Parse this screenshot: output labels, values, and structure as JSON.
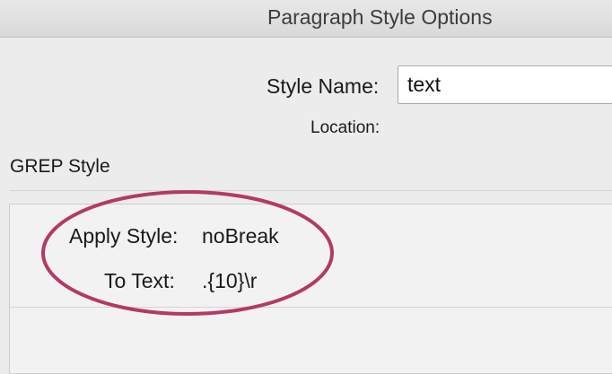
{
  "window": {
    "title": "Paragraph Style Options"
  },
  "general": {
    "style_name_label": "Style Name:",
    "style_name_value": "text",
    "location_label": "Location:"
  },
  "grep_style": {
    "heading": "GREP Style",
    "rules": [
      {
        "apply_style_label": "Apply Style:",
        "apply_style_value": "noBreak",
        "to_text_label": "To Text:",
        "to_text_value": ".{10}\\r"
      }
    ]
  },
  "annotation": {
    "highlight_color": "#b33a63"
  }
}
